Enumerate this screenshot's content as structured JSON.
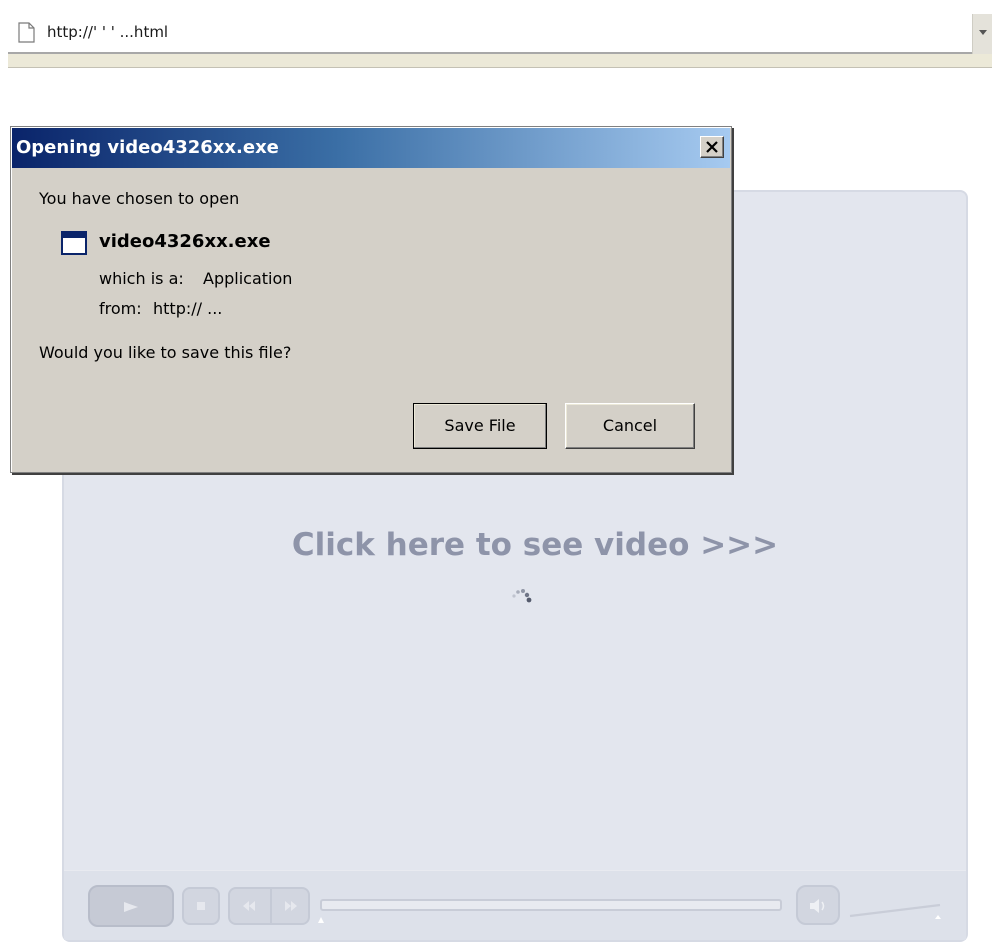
{
  "browser": {
    "url": "http://'      '  ' ...html"
  },
  "dialog": {
    "title": "Opening video4326xx.exe",
    "chosen_text": "You have chosen to open",
    "file_name": "video4326xx.exe",
    "which_label": "which is a:",
    "which_value": "Application",
    "from_label": "from:",
    "from_value": "http://           ...",
    "question": "Would you like to save this file?",
    "save_label": "Save File",
    "cancel_label": "Cancel"
  },
  "player": {
    "prompt": "Click here to see video >>>",
    "progress": 0
  },
  "colors": {
    "titlebar_start": "#0a246a",
    "titlebar_end": "#a6caf0",
    "dialog_bg": "#d4d0c8",
    "player_bg": "#e3e6ee",
    "prompt_text": "#8e94a9"
  }
}
